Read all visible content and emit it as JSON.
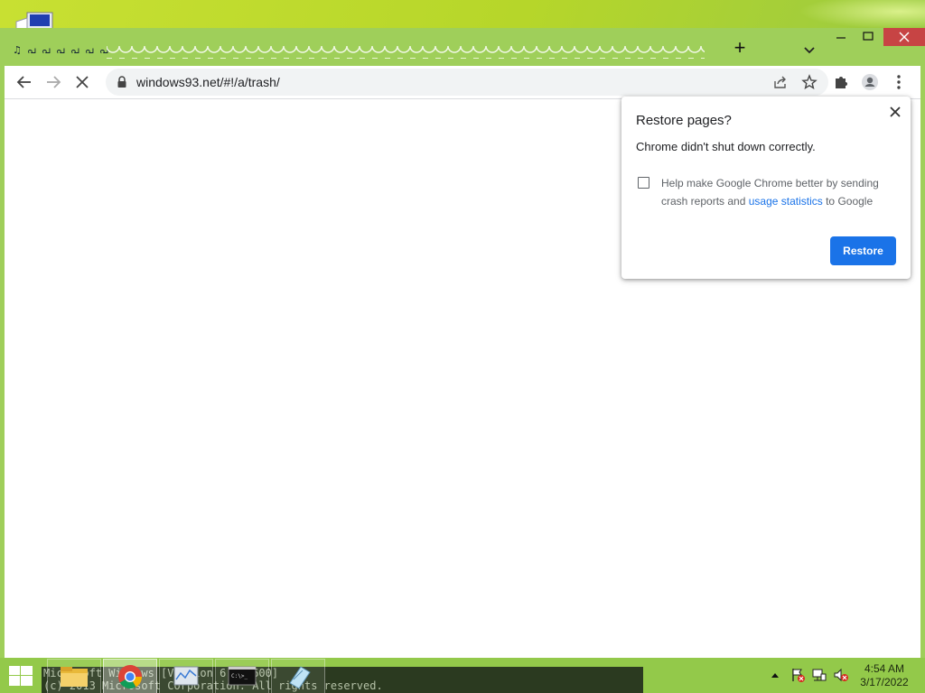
{
  "browser": {
    "url": "windows93.net/#!/a/trash/",
    "tab_glyphs": [
      "♫",
      "പ",
      "പ",
      "പ",
      "പ",
      "പ",
      "പ"
    ]
  },
  "dialog": {
    "title": "Restore pages?",
    "message": "Chrome didn't shut down correctly.",
    "help_prefix": "Help make Google Chrome better by sending crash reports and ",
    "help_link": "usage statistics",
    "help_suffix": " to Google",
    "restore_label": "Restore",
    "accent": "#1a73e8"
  },
  "console": {
    "line1": "Microsoft Windows [Version 6.3.9600]",
    "line2": "(c) 2013 Microsoft Corporation. All rights reserved."
  },
  "taskbar": {
    "items": [
      "file-explorer",
      "chrome",
      "task-manager",
      "command-prompt",
      "notepad"
    ],
    "time": "4:54 AM",
    "date": "3/17/2022"
  }
}
